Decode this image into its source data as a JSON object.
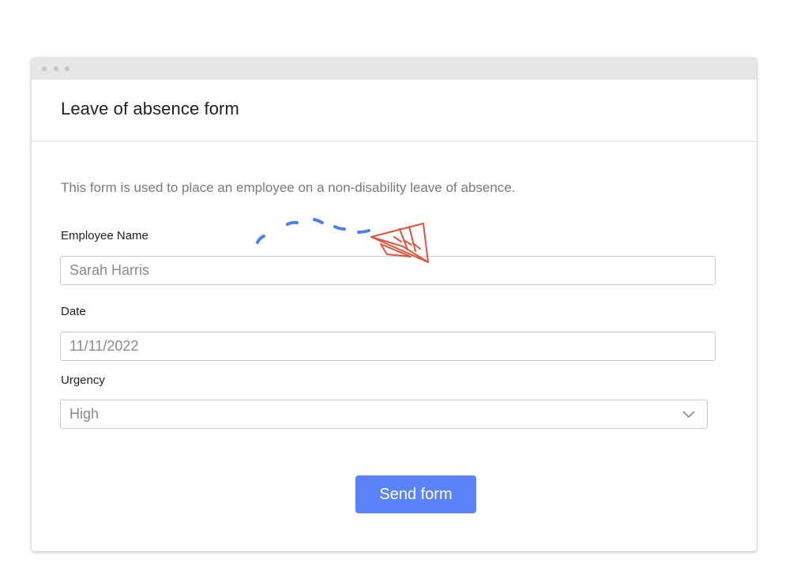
{
  "form": {
    "title": "Leave of absence form",
    "description": "This form is used to place an employee on a non-disability leave of absence.",
    "fields": {
      "employee_name": {
        "label": "Employee Name",
        "value": "Sarah Harris"
      },
      "date": {
        "label": "Date",
        "value": "11/11/2022"
      },
      "urgency": {
        "label": "Urgency",
        "value": "High"
      }
    },
    "submit_label": "Send form"
  },
  "colors": {
    "accent": "#5b82f6",
    "doodle_trail": "#4f7ef4",
    "doodle_plane": "#e0533d"
  },
  "icons": {
    "urgency_dropdown": "chevron-down-icon",
    "illustration": "paper-plane-icon"
  }
}
